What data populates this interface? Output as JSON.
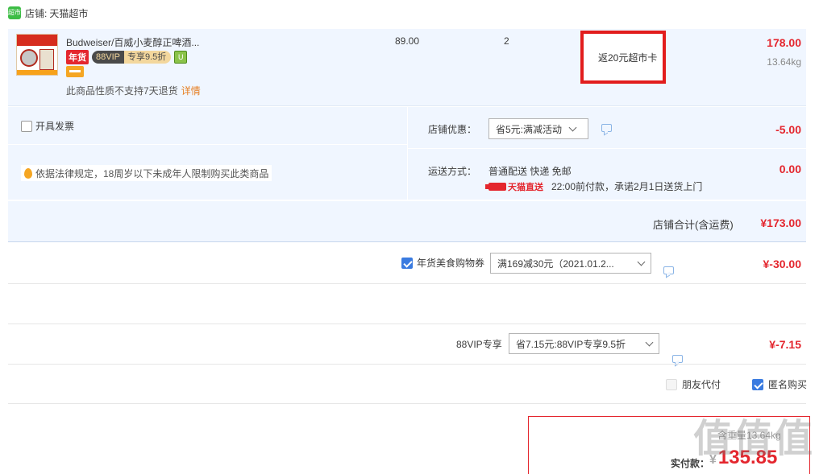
{
  "shop": {
    "label": "店铺:",
    "name": "天猫超市",
    "logo_text": "超市"
  },
  "item": {
    "title": "Budweiser/百威小麦醇正啤酒...",
    "badge_nianhuo": "年货",
    "vip_badge": {
      "left": "88VIP",
      "right": "专享9.5折"
    },
    "green_badge_text": "U",
    "no_return_text": "此商品性质不支持7天退货",
    "detail_link": "详情",
    "unit_price": "89.00",
    "quantity": "2",
    "rebate": "返20元超市卡",
    "total": "178.00",
    "weight": "13.64kg"
  },
  "invoice": {
    "label": "开具发票"
  },
  "law_notice": "依据法律规定，18周岁以下未成年人限制购买此类商品",
  "shop_discount": {
    "label": "店铺优惠：",
    "selected": "省5元:满减活动",
    "value": "-5.00"
  },
  "shipping": {
    "label": "运送方式：",
    "method": "普通配送 快递 免邮",
    "tag": "天猫直送",
    "promise": "22:00前付款，承诺2月1日送货上门",
    "value": "0.00"
  },
  "shop_total": {
    "label": "店铺合计(含运费)",
    "value": "¥173.00"
  },
  "coupon": {
    "label": "年货美食购物券",
    "selected": "满169减30元（2021.01.2...",
    "value": "¥-30.00",
    "checked": true
  },
  "vip_promo": {
    "label": "88VIP专享",
    "selected": "省7.15元:88VIP专享9.5折",
    "value": "¥-7.15"
  },
  "options": {
    "friend_pay": "朋友代付",
    "anonymous": "匿名购买"
  },
  "payment": {
    "sub_text": "含重量13.64kg",
    "label": "实付款：",
    "currency": "¥",
    "amount": "135.85"
  },
  "watermark": "值值值",
  "colors": {
    "accent_red": "#e4262e",
    "light_blue": "#f0f6ff",
    "check_blue": "#3a7be0"
  }
}
